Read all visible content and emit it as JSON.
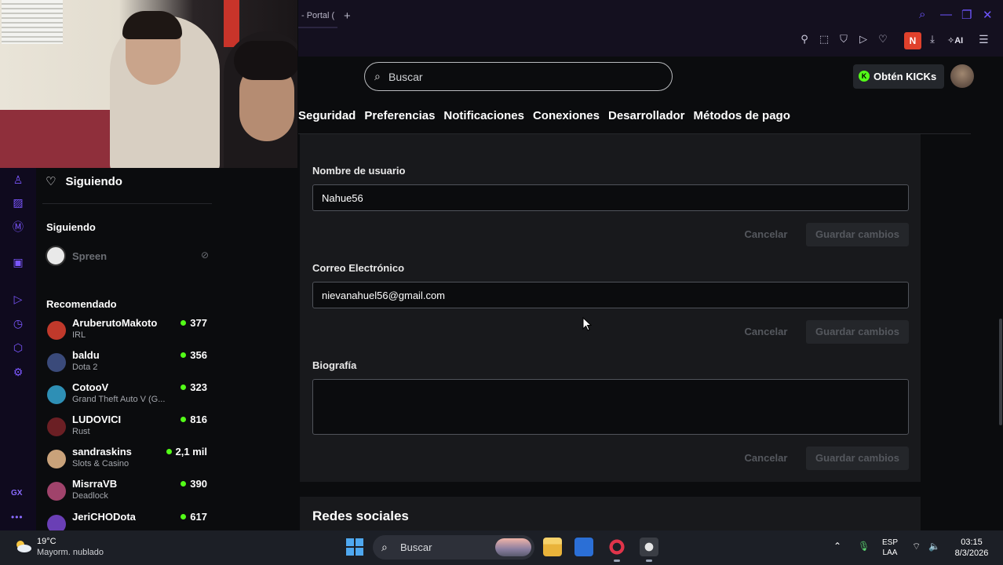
{
  "browser": {
    "tab_title": "- Portal (",
    "tab_add": "+",
    "ai_label": "AI",
    "n_badge": "N"
  },
  "search": {
    "placeholder": "Buscar"
  },
  "header": {
    "kicks_label": "Obtén KICKs",
    "kicks_icon": "K"
  },
  "settings_tabs": [
    "Seguridad",
    "Preferencias",
    "Notificaciones",
    "Conexiones",
    "Desarrollador",
    "Métodos de pago"
  ],
  "form": {
    "username_label": "Nombre de usuario",
    "username_value": "Nahue56",
    "email_label": "Correo Electrónico",
    "email_value": "nievanahuel56@gmail.com",
    "bio_label": "Biografía",
    "bio_value": "",
    "cancel_label": "Cancelar",
    "save_label": "Guardar cambios"
  },
  "social_section_title": "Redes sociales",
  "sidebar": {
    "following_title": "Siguiendo",
    "following_section": "Siguiendo",
    "offline_channel": "Spreen",
    "recommended_section": "Recomendado",
    "recommended": [
      {
        "name": "AruberutoMakoto",
        "category": "IRL",
        "viewers": "377",
        "avatar_color": "#c0392b"
      },
      {
        "name": "baldu",
        "category": "Dota 2",
        "viewers": "356",
        "avatar_color": "#3a4a7a"
      },
      {
        "name": "CotooV",
        "category": "Grand Theft Auto V (G...",
        "viewers": "323",
        "avatar_color": "#2e8fb5"
      },
      {
        "name": "LUDOVICI",
        "category": "Rust",
        "viewers": "816",
        "avatar_color": "#6b1f24"
      },
      {
        "name": "sandraskins",
        "category": "Slots & Casino",
        "viewers": "2,1 mil",
        "avatar_color": "#c9a27a"
      },
      {
        "name": "MisrraVB",
        "category": "Deadlock",
        "viewers": "390",
        "avatar_color": "#a0436b"
      },
      {
        "name": "JeriCHODota",
        "category": "",
        "viewers": "617",
        "avatar_color": "#6a3fb5"
      }
    ]
  },
  "rail": {
    "gx_label": "GX",
    "more_label": "•••"
  },
  "taskbar": {
    "temperature": "19°C",
    "weather": "Mayorm. nublado",
    "search_label": "Buscar",
    "lang_top": "ESP",
    "lang_bottom": "LAA",
    "time": "03:15",
    "date": "8/3/2026"
  },
  "colors": {
    "kick_green": "#53fc18",
    "opera_purple": "#7b57ff",
    "panel_bg": "#18191c",
    "page_bg": "#0b0c0e"
  }
}
